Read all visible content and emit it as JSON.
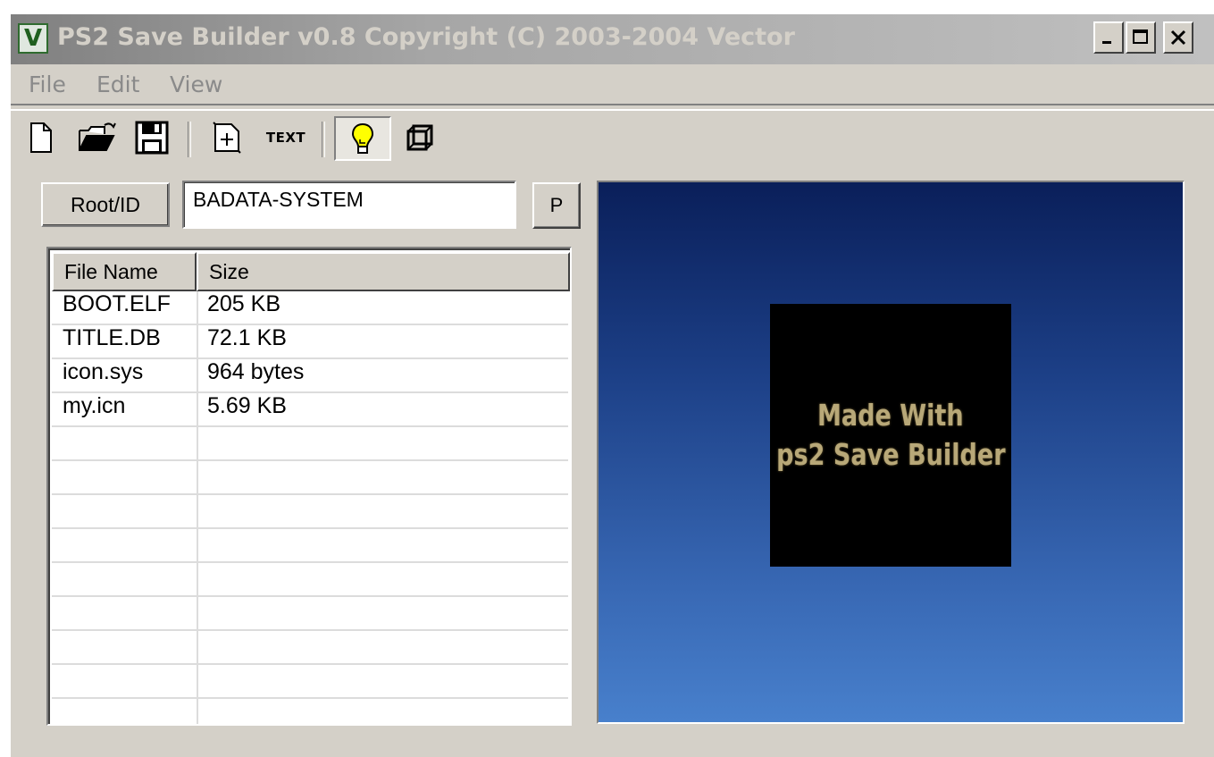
{
  "window": {
    "title": "PS2 Save Builder v0.8 Copyright (C) 2003-2004 Vector",
    "app_icon_letter": "V"
  },
  "menu": [
    "File",
    "Edit",
    "View"
  ],
  "toolbar": {
    "buttons": [
      "new-file-icon",
      "open-folder-icon",
      "save-disk-icon",
      "add-file-icon",
      "text-button",
      "lightbulb-icon",
      "3d-cube-icon"
    ],
    "text_label": "TEXT",
    "pressed": "lightbulb-icon"
  },
  "root_id": {
    "label": "Root/ID",
    "value": "BADATA-SYSTEM",
    "button_label": "P"
  },
  "file_list": {
    "columns": [
      "File Name",
      "Size"
    ],
    "rows": [
      {
        "name": "BOOT.ELF",
        "size": "205 KB"
      },
      {
        "name": "TITLE.DB",
        "size": "72.1 KB"
      },
      {
        "name": "icon.sys",
        "size": "964 bytes"
      },
      {
        "name": "my.icn",
        "size": "5.69 KB"
      }
    ]
  },
  "preview": {
    "line1": "Made With",
    "line2": "ps2 Save Builder"
  },
  "colors": {
    "face": "#d4d0c8",
    "title_gradient_start": "#808080",
    "title_gradient_end": "#c0c0c0",
    "preview_top": "#0a1f5a",
    "preview_bottom": "#4880cc",
    "preview_text": "#b8a878"
  }
}
